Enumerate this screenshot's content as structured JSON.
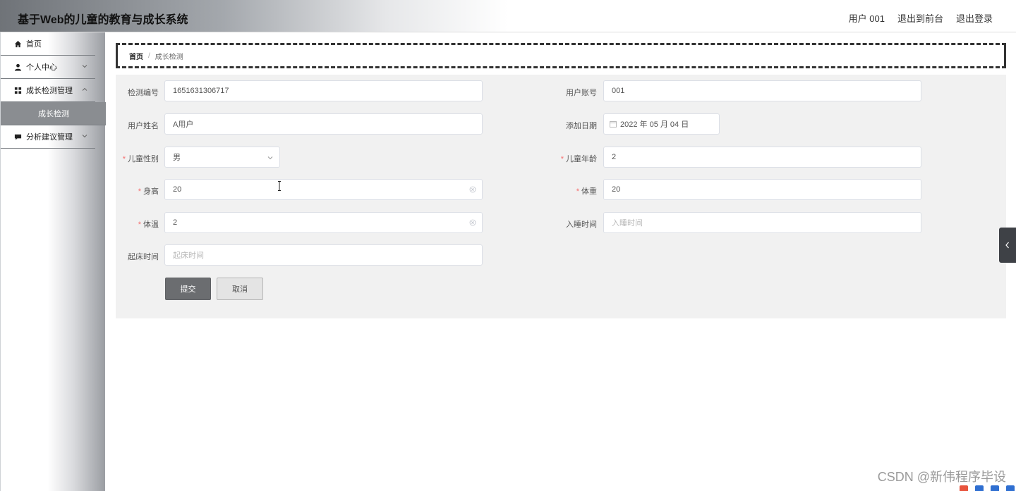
{
  "header": {
    "title": "基于Web的儿童的教育与成长系统",
    "links": [
      "用户 001",
      "退出到前台",
      "退出登录"
    ]
  },
  "sidebar": {
    "items": [
      {
        "label": "首页",
        "icon": "home-icon"
      },
      {
        "label": "个人中心",
        "icon": "user-icon"
      },
      {
        "label": "成长检测管理",
        "icon": "grid-icon"
      },
      {
        "label": "成长检测",
        "icon": ""
      },
      {
        "label": "分析建议管理",
        "icon": "comment-icon"
      }
    ]
  },
  "breadcrumb": {
    "home": "首页",
    "separator": "/",
    "current": "成长检测"
  },
  "form": {
    "jiance_bianhao": {
      "label": "检测编号",
      "value": "1651631306717"
    },
    "yonghu_zhanghao": {
      "label": "用户账号",
      "value": "001"
    },
    "yonghu_xingming": {
      "label": "用户姓名",
      "value": "A用户"
    },
    "tianjia_riqi": {
      "label": "添加日期",
      "value": "2022 年 05 月 04 日"
    },
    "ertong_xingbie": {
      "label": "儿童性别",
      "value": "男",
      "required_mark": "*"
    },
    "ertong_nianling": {
      "label": "儿童年龄",
      "value": "2",
      "required_mark": "*"
    },
    "shengao": {
      "label": "身高",
      "value": "20",
      "required_mark": "*"
    },
    "tizhong": {
      "label": "体重",
      "value": "20",
      "required_mark": "*"
    },
    "tiwen": {
      "label": "体温",
      "value": "2",
      "required_mark": "*"
    },
    "rushui_shijian": {
      "label": "入睡时间",
      "placeholder": "入睡时间"
    },
    "qichuang_shijian": {
      "label": "起床时间",
      "placeholder": "起床时间"
    },
    "submit_label": "提交",
    "cancel_label": "取消"
  },
  "watermark": "CSDN @新伟程序毕设",
  "colors": {
    "required": "#f56c6c",
    "submit_bg": "#6b6d70",
    "panel_bg": "#f1f1f1",
    "side_toggle_bg": "#3e4146"
  }
}
